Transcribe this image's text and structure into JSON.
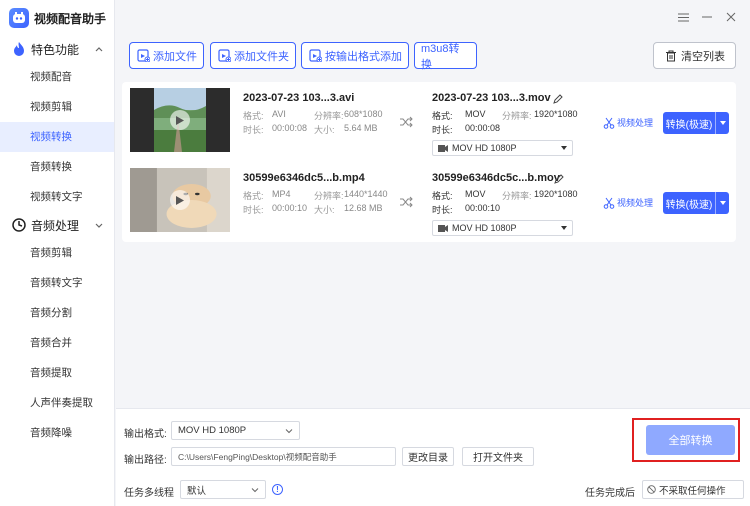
{
  "app": {
    "title": "视频配音助手",
    "accent": "#3d63ff"
  },
  "sidebar": {
    "group1": {
      "label": "特色功能",
      "items": [
        "视频配音",
        "视频剪辑",
        "视频转换",
        "音频转换",
        "视频转文字"
      ],
      "active": "视频转换"
    },
    "group2": {
      "label": "音频处理",
      "items": [
        "音频剪辑",
        "音频转文字",
        "音频分割",
        "音频合并",
        "音频提取",
        "人声伴奏提取",
        "音频降噪"
      ]
    }
  },
  "toolbar": {
    "add_file": "添加文件",
    "add_folder": "添加文件夹",
    "add_by_format": "按输出格式添加",
    "m3u8": "m3u8转换",
    "clear": "清空列表"
  },
  "files": [
    {
      "src_name": "2023-07-23 103...3.avi",
      "src_format_label": "格式:",
      "src_format": "AVI",
      "src_res_label": "分辨率:",
      "src_res": "608*1080",
      "src_dur_label": "时长:",
      "src_dur": "00:00:08",
      "src_size_label": "大小:",
      "src_size": "5.64 MB",
      "out_name": "2023-07-23 103...3.mov",
      "out_format_label": "格式:",
      "out_format": "MOV",
      "out_res_label": "分辨率:",
      "out_res": "1920*1080",
      "out_dur_label": "时长:",
      "out_dur": "00:00:08",
      "preset": "MOV  HD 1080P",
      "process": "视频处理",
      "convert": "转换(极速)"
    },
    {
      "src_name": "30599e6346dc5...b.mp4",
      "src_format_label": "格式:",
      "src_format": "MP4",
      "src_res_label": "分辨率:",
      "src_res": "1440*1440",
      "src_dur_label": "时长:",
      "src_dur": "00:00:10",
      "src_size_label": "大小:",
      "src_size": "12.68 MB",
      "out_name": "30599e6346dc5c...b.mov",
      "out_format_label": "格式:",
      "out_format": "MOV",
      "out_res_label": "分辨率:",
      "out_res": "1920*1080",
      "out_dur_label": "时长:",
      "out_dur": "00:00:10",
      "preset": "MOV  HD 1080P",
      "process": "视频处理",
      "convert": "转换(极速)"
    }
  ],
  "bottom": {
    "output_format_label": "输出格式:",
    "output_format": "MOV  HD 1080P",
    "output_path_label": "输出路径:",
    "output_path": "C:\\Users\\FengPing\\Desktop\\视频配音助手",
    "change_dir": "更改目录",
    "open_folder": "打开文件夹",
    "multi_thread_label": "任务多线程",
    "multi_thread": "默认",
    "on_complete_label": "任务完成后",
    "on_complete": "不采取任何操作",
    "convert_all": "全部转换"
  }
}
